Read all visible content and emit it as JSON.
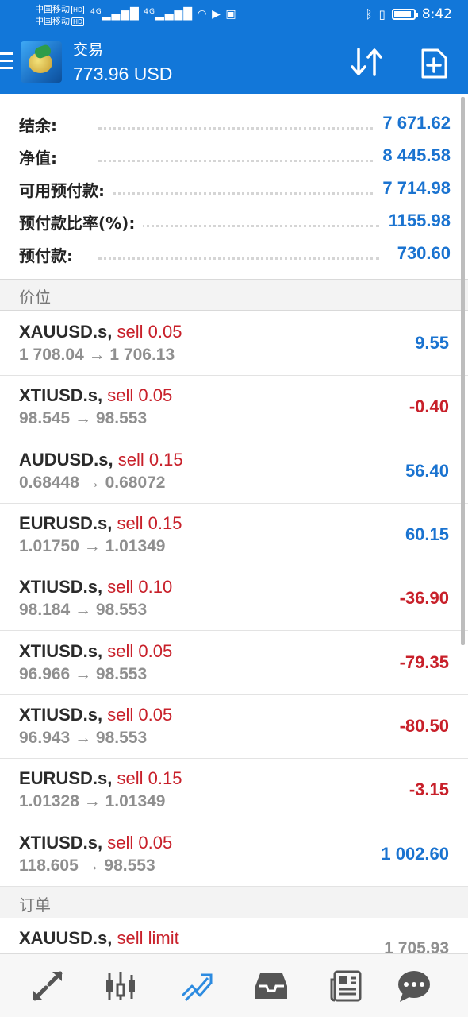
{
  "status_bar": {
    "carrier1": "中国移动",
    "carrier2": "中国移动",
    "hd": "HD",
    "time": "8:42",
    "network": "4G",
    "battery_level": 0.9
  },
  "app_bar": {
    "title": "交易",
    "balance": "773.96 USD"
  },
  "summary": [
    {
      "label": "结余:",
      "value": "7 671.62"
    },
    {
      "label": "净值:",
      "value": "8 445.58"
    },
    {
      "label": "可用预付款:",
      "value": "7 714.98"
    },
    {
      "label": "预付款比率(%):",
      "value": "1155.98"
    },
    {
      "label": "预付款:",
      "value": "730.60"
    }
  ],
  "positions_header": "价位",
  "positions": [
    {
      "symbol": "XAUUSD.s,",
      "side": "sell 0.05",
      "prices": "1 708.04 → 1 706.13",
      "profit": "9.55",
      "sign": "pos"
    },
    {
      "symbol": "XTIUSD.s,",
      "side": "sell 0.05",
      "prices": "98.545 → 98.553",
      "profit": "-0.40",
      "sign": "neg"
    },
    {
      "symbol": "AUDUSD.s,",
      "side": "sell 0.15",
      "prices": "0.68448 → 0.68072",
      "profit": "56.40",
      "sign": "pos"
    },
    {
      "symbol": "EURUSD.s,",
      "side": "sell 0.15",
      "prices": "1.01750 → 1.01349",
      "profit": "60.15",
      "sign": "pos"
    },
    {
      "symbol": "XTIUSD.s,",
      "side": "sell 0.10",
      "prices": "98.184 → 98.553",
      "profit": "-36.90",
      "sign": "neg"
    },
    {
      "symbol": "XTIUSD.s,",
      "side": "sell 0.05",
      "prices": "96.966 → 98.553",
      "profit": "-79.35",
      "sign": "neg"
    },
    {
      "symbol": "XTIUSD.s,",
      "side": "sell 0.05",
      "prices": "96.943 → 98.553",
      "profit": "-80.50",
      "sign": "neg"
    },
    {
      "symbol": "EURUSD.s,",
      "side": "sell 0.15",
      "prices": "1.01328 → 1.01349",
      "profit": "-3.15",
      "sign": "neg"
    },
    {
      "symbol": "XTIUSD.s,",
      "side": "sell 0.05",
      "prices": "118.605 → 98.553",
      "profit": "1 002.60",
      "sign": "pos"
    }
  ],
  "orders_header": "订单",
  "orders": [
    {
      "symbol": "XAUUSD.s,",
      "side": "sell limit",
      "price": "1 705.93"
    }
  ],
  "bottom_nav": [
    {
      "icon": "quotes-icon",
      "active": false
    },
    {
      "icon": "chart-candles-icon",
      "active": false
    },
    {
      "icon": "trade-icon",
      "active": true
    },
    {
      "icon": "history-inbox-icon",
      "active": false
    },
    {
      "icon": "news-icon",
      "active": false
    },
    {
      "icon": "chat-icon",
      "active": false
    }
  ],
  "colors": {
    "brand_blue": "#1277d9",
    "profit_blue": "#1a73d0",
    "loss_red": "#c8202a",
    "active_nav": "#2d8be0",
    "inactive_nav": "#555555"
  }
}
